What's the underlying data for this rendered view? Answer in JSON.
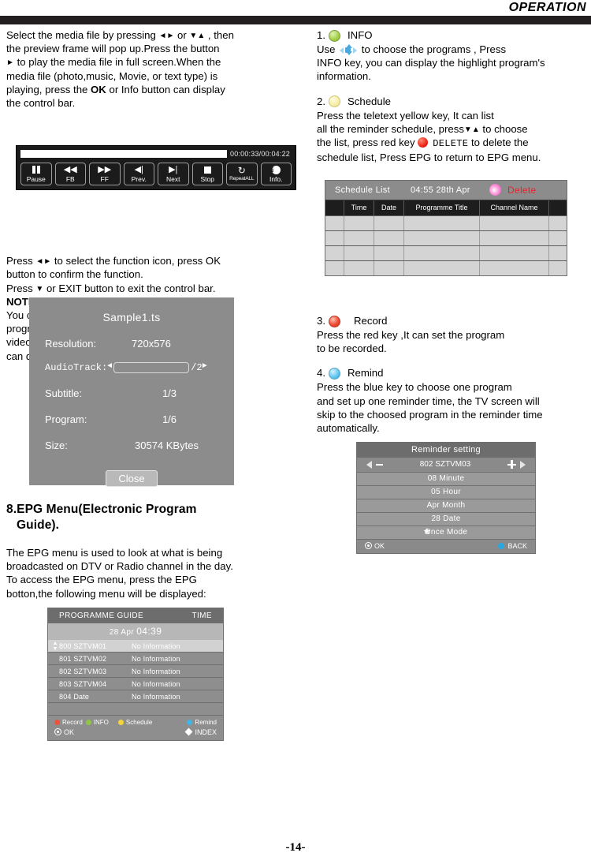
{
  "header": {
    "title": "OPERATION"
  },
  "page": {
    "number": "-14-"
  },
  "left": {
    "para1": "Select the media file by pressing ◄► or ▼▲ , then the preview frame will pop up.Press the button ► to play the media file in full screen.When the media file (photo,music, Movie, or text type) is playing, press the OK or Info button can display the control bar.",
    "p1_a": "Select the media file by pressing",
    "p1_b": "or",
    "p1_c": ", then",
    "p1_d": "the preview frame will pop up.Press the button",
    "p1_e": "to play the media file in full screen.When the",
    "p1_f": "media file (photo,music, Movie, or text type) is",
    "p1_g": "playing, press the",
    "p1_ok": "OK",
    "p1_h": "or Info button can display",
    "p1_i": "the control bar.",
    "p2_a": "Press",
    "p2_b": "to select the function icon, press OK",
    "p2_c": "button to confirm the function.",
    "p2_d": "Press",
    "p2_e": "or EXIT button to exit the control bar.",
    "note_label": "NOTE:",
    "note_1": "You can adjust the audio track, subtitle, or",
    "note_2": "program in the Info menu while Playing the",
    "note_3": "video file.Choose the Info icon and press OK",
    "note_4": "can display the Info MENU.",
    "section_title_1": "8.EPG Menu(Electronic Program",
    "section_title_2": "Guide).",
    "epg_p1": "The EPG menu is used to look at what is being",
    "epg_p2": "broadcasted on DTV or Radio channel  in the day.",
    "epg_p3": "To access the EPG menu, press the EPG",
    "epg_p4": "botton,the following menu will be displayed:"
  },
  "control_bar": {
    "time": "00:00:33/00:04:22",
    "progress_percent": 100,
    "buttons": [
      {
        "label": "Pause",
        "icon": "pause-icon"
      },
      {
        "label": "FB",
        "icon": "fast-backward-icon"
      },
      {
        "label": "FF",
        "icon": "fast-forward-icon"
      },
      {
        "label": "Prev.",
        "icon": "previous-icon"
      },
      {
        "label": "Next",
        "icon": "next-icon"
      },
      {
        "label": "Stop",
        "icon": "stop-icon"
      },
      {
        "label": "RepeatALL",
        "icon": "repeat-icon"
      },
      {
        "label": "Info.",
        "icon": "info-icon"
      }
    ]
  },
  "info_panel": {
    "title": "Sample1.ts",
    "resolution_label": "Resolution:",
    "resolution_value": "720x576",
    "audiotrack_label": "AudioTrack:",
    "audiotrack_value": "/2",
    "subtitle_label": "Subtitle:",
    "subtitle_value": "1/3",
    "program_label": "Program:",
    "program_value": "1/6",
    "size_label": "Size:",
    "size_value": "30574 KBytes",
    "close_label": "Close"
  },
  "epg_guide": {
    "title": "PROGRAMME GUIDE",
    "time_label": "TIME",
    "date": "28 Apr ",
    "clock": "04:39",
    "rows": [
      {
        "channel": "800 SZTVM01",
        "info": "No Information",
        "selected": true
      },
      {
        "channel": "801 SZTVM02",
        "info": "No Information",
        "selected": false
      },
      {
        "channel": "802 SZTVM03",
        "info": "No Information",
        "selected": false
      },
      {
        "channel": "803 SZTVM04",
        "info": "No Information",
        "selected": false
      },
      {
        "channel": "804 Date",
        "info": "No Information",
        "selected": false
      }
    ],
    "keys": [
      {
        "label": "Record",
        "color": "#e8553c"
      },
      {
        "label": "INFO",
        "color": "#8fc742"
      },
      {
        "label": "Schedule",
        "color": "#f2d53c"
      },
      {
        "label": "Remind",
        "color": "#3fb5e8"
      }
    ],
    "ok_label": "OK",
    "index_label": "INDEX"
  },
  "right": {
    "item1": {
      "num": "1.",
      "title": "INFO",
      "ball_color": "#a8d24a",
      "l1_a": "Use",
      "l1_b": "to choose the programs , Press",
      "l2": "INFO key, you  can display the highlight  program's",
      "l3": "information."
    },
    "item2": {
      "num": "2.",
      "title": "Schedule",
      "ball_color": "#f7efab",
      "l1": "Press  the  teletext yellow key, It can list",
      "l2_a": "all the reminder schedule, press",
      "l2_b": "to choose",
      "l3_a": "the list,  press red key",
      "l3_delete": "DELETE",
      "l3_b": "to delete the",
      "l4": "schedule list, Press EPG  to return to EPG  menu."
    },
    "item3": {
      "num": "3.",
      "title": "Record",
      "ball_color": "#ef4b34",
      "l1": "Press  the  red key ,It can set the program",
      "l2": "to be recorded."
    },
    "item4": {
      "num": "4.",
      "title": "Remind",
      "ball_color": "#63c8f2",
      "l1": "Press the blue key to choose one program",
      "l2": "and set up one reminder time, the TV screen will",
      "l3": "skip to the choosed program in the reminder time",
      "l4": "automatically."
    }
  },
  "schedule_list": {
    "title": "Schedule List",
    "time": "04:55  28th Apr",
    "delete_label": "Delete",
    "columns": [
      "",
      "Time",
      "Date",
      "Programme Title",
      "Channel Name",
      ""
    ],
    "rows": [
      [
        "",
        "",
        "",
        "",
        "",
        ""
      ],
      [
        "",
        "",
        "",
        "",
        "",
        ""
      ],
      [
        "",
        "",
        "",
        "",
        "",
        ""
      ],
      [
        "",
        "",
        "",
        "",
        "",
        ""
      ]
    ]
  },
  "reminder_setting": {
    "title": "Reminder setting",
    "channel": "802 SZTVM03",
    "items": [
      "08 Minute",
      "05 Hour",
      "Apr Month",
      "28 Date",
      "Once Mode"
    ],
    "star_index": 4,
    "ok_label": "OK",
    "back_label": "BACK"
  }
}
